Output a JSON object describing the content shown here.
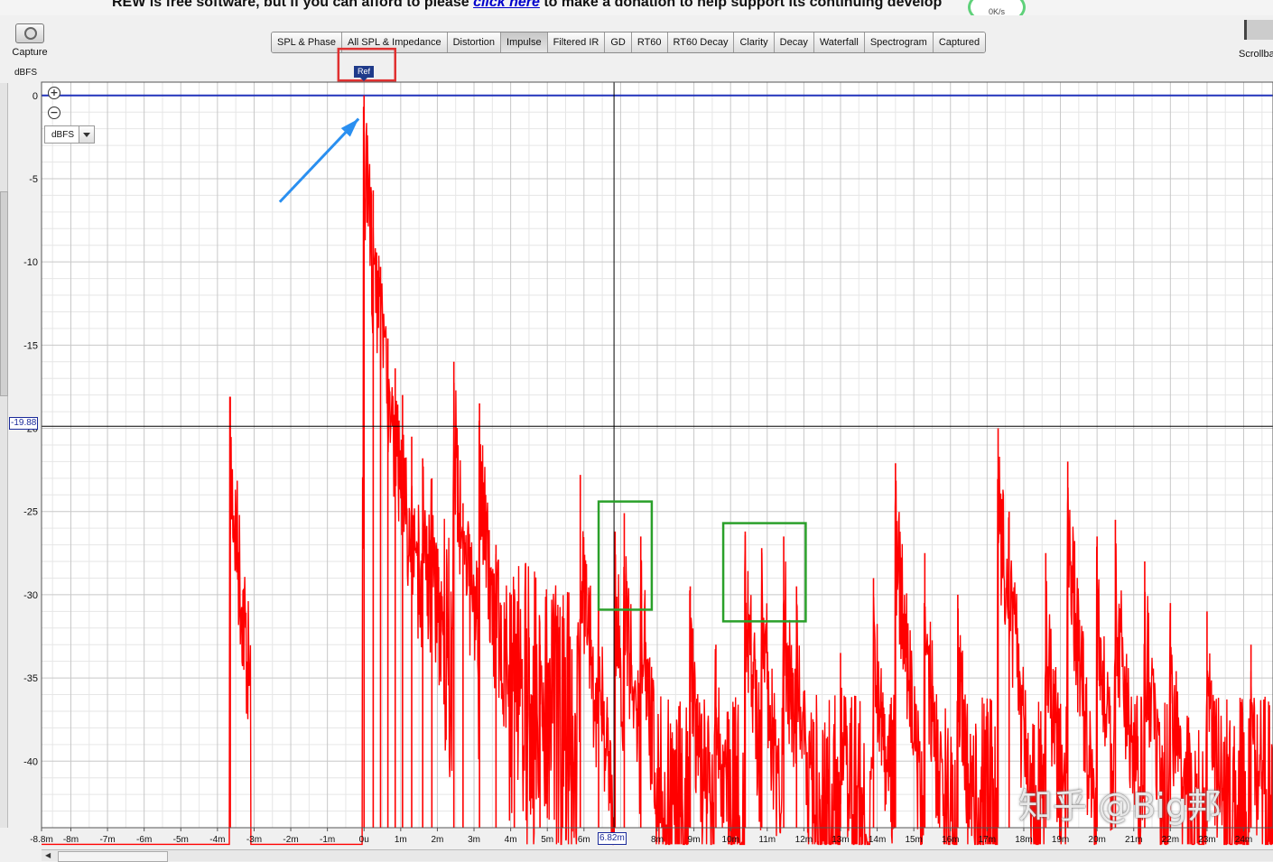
{
  "banner": {
    "before": "REW is free software, but if you can afford to please ",
    "link": "click here",
    "after": " to make a donation to help support its continuing develop"
  },
  "network_widget": {
    "speed": "0K/s"
  },
  "toolbar": {
    "capture_label": "Capture",
    "scrollbars_label": "Scrollba",
    "tabs": [
      {
        "label": "SPL & Phase"
      },
      {
        "label": "All SPL & Impedance"
      },
      {
        "label": "Distortion"
      },
      {
        "label": "Impulse",
        "active": true
      },
      {
        "label": "Filtered IR"
      },
      {
        "label": "GD"
      },
      {
        "label": "RT60"
      },
      {
        "label": "RT60 Decay"
      },
      {
        "label": "Clarity"
      },
      {
        "label": "Decay"
      },
      {
        "label": "Waterfall"
      },
      {
        "label": "Spectrogram"
      },
      {
        "label": "Captured"
      }
    ]
  },
  "plot": {
    "unit_label": "dBFS",
    "y_unit_select": "dBFS",
    "ref_marker": "Ref",
    "cursor_y_readout": "-19.88",
    "cursor_x_readout": "6.82m"
  },
  "watermark": "知乎 @Big邦",
  "chart_data": {
    "type": "line",
    "series_color": "#ff0000",
    "ylabel": "dBFS",
    "ylim": [
      -44,
      0.8
    ],
    "xlim": [
      -8.8,
      24.8
    ],
    "x_unit": "ms",
    "y_ticks": [
      0,
      -5,
      -10,
      -15,
      -20,
      -25,
      -30,
      -35,
      -40
    ],
    "y_tick_labels": [
      "0",
      "-5",
      "-10",
      "-15",
      "-20",
      "-25",
      "-30",
      "-35",
      "-40"
    ],
    "x_ticks": [
      -8.8,
      -8,
      -7,
      -6,
      -5,
      -4,
      -3,
      -2,
      -1,
      0,
      1,
      2,
      3,
      4,
      5,
      6,
      8,
      9,
      10,
      11,
      12,
      13,
      14,
      15,
      16,
      17,
      18,
      19,
      20,
      21,
      22,
      23,
      24
    ],
    "x_tick_labels": [
      "-8.8m",
      "-8m",
      "-7m",
      "-6m",
      "-5m",
      "-4m",
      "-3m",
      "-2m",
      "-1m",
      "0u",
      "1m",
      "2m",
      "3m",
      "4m",
      "5m",
      "6m",
      "8m",
      "9m",
      "10m",
      "11m",
      "12m",
      "13m",
      "14m",
      "15m",
      "16m",
      "17m",
      "18m",
      "19m",
      "20m",
      "21m",
      "22m",
      "23m",
      "24m"
    ],
    "reference_level": 0,
    "cursor": {
      "x": 6.82,
      "y": -19.88
    },
    "peaks": [
      {
        "x": -3.65,
        "y": -18.1
      },
      {
        "x": 0.0,
        "y": 0.0
      },
      {
        "x": 0.25,
        "y": -5.7
      },
      {
        "x": 0.45,
        "y": -10.3
      },
      {
        "x": 0.65,
        "y": -14.6
      },
      {
        "x": 0.85,
        "y": -16.4
      },
      {
        "x": 1.05,
        "y": -18.0
      },
      {
        "x": 1.3,
        "y": -20.5
      },
      {
        "x": 1.6,
        "y": -21.8
      },
      {
        "x": 1.85,
        "y": -23.0
      },
      {
        "x": 2.45,
        "y": -16.0
      },
      {
        "x": 2.7,
        "y": -24.5
      },
      {
        "x": 3.15,
        "y": -18.5
      },
      {
        "x": 3.6,
        "y": -27.0
      },
      {
        "x": 4.1,
        "y": -30.0
      },
      {
        "x": 4.8,
        "y": -33.0
      },
      {
        "x": 5.9,
        "y": -22.8
      },
      {
        "x": 6.4,
        "y": -30.5
      },
      {
        "x": 6.85,
        "y": -26.2
      },
      {
        "x": 7.1,
        "y": -25.1
      },
      {
        "x": 7.55,
        "y": -26.5
      },
      {
        "x": 8.9,
        "y": -29.5
      },
      {
        "x": 9.6,
        "y": -33.0
      },
      {
        "x": 10.4,
        "y": -26.2
      },
      {
        "x": 10.85,
        "y": -27.2
      },
      {
        "x": 11.45,
        "y": -26.5
      },
      {
        "x": 11.8,
        "y": -29.5
      },
      {
        "x": 13.0,
        "y": -33.5
      },
      {
        "x": 13.9,
        "y": -29.0
      },
      {
        "x": 14.5,
        "y": -22.1
      },
      {
        "x": 15.3,
        "y": -27.5
      },
      {
        "x": 16.2,
        "y": -30.0
      },
      {
        "x": 17.3,
        "y": -20.0
      },
      {
        "x": 17.6,
        "y": -25.0
      },
      {
        "x": 18.6,
        "y": -27.5
      },
      {
        "x": 19.2,
        "y": -22.0
      },
      {
        "x": 20.0,
        "y": -26.5
      },
      {
        "x": 20.5,
        "y": -25.5
      },
      {
        "x": 21.3,
        "y": -28.0
      },
      {
        "x": 22.0,
        "y": -30.5
      },
      {
        "x": 23.0,
        "y": -31.0
      },
      {
        "x": 24.2,
        "y": -33.0
      }
    ]
  },
  "annotations": [
    {
      "type": "box",
      "color": "#e03030",
      "x_range": [
        -0.7,
        0.85
      ],
      "y_range": [
        0.9,
        2.8
      ]
    },
    {
      "type": "box",
      "color": "#2aa02a",
      "x_range": [
        6.4,
        7.85
      ],
      "y_range": [
        -24.4,
        -30.9
      ]
    },
    {
      "type": "box",
      "color": "#2aa02a",
      "x_range": [
        9.8,
        12.05
      ],
      "y_range": [
        -25.7,
        -31.6
      ]
    },
    {
      "type": "arrow",
      "color": "#2a8ff0",
      "from": {
        "x": -2.3,
        "y": -6.4
      },
      "to": {
        "x": -0.15,
        "y": -1.4
      }
    }
  ]
}
